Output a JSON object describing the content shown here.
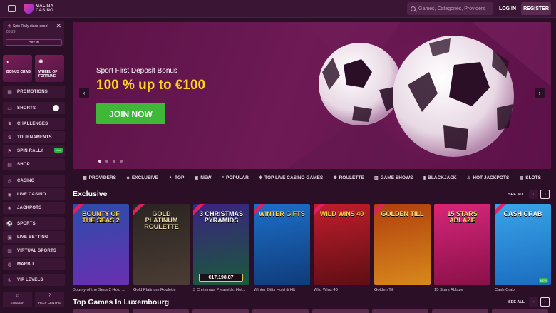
{
  "header": {
    "logo_line1": "MALINA",
    "logo_line2": "CASINO",
    "search_placeholder": "Games, Categories, Providers",
    "login_label": "LOG IN",
    "register_label": "REGISTER"
  },
  "sidebar": {
    "notice": {
      "text": "Spin Rally starts soon!",
      "time": "00:29",
      "button": "OPT IN"
    },
    "tiles": [
      {
        "label": "BONUS CRAB",
        "icon": "crab-icon"
      },
      {
        "label": "WHEEL OF FORTUNE",
        "icon": "wheel-icon"
      }
    ],
    "items": [
      {
        "label": "PROMOTIONS",
        "icon": "gift-icon"
      },
      {
        "label": "SHORTS",
        "icon": "video-icon"
      },
      {
        "label": "CHALLENGES",
        "icon": "trophy-icon"
      },
      {
        "label": "TOURNAMENTS",
        "icon": "cup-icon"
      },
      {
        "label": "SPIN RALLY",
        "icon": "runner-icon",
        "badge": "New"
      },
      {
        "label": "SHOP",
        "icon": "cart-icon"
      },
      {
        "label": "CASINO",
        "icon": "chip-icon"
      },
      {
        "label": "LIVE CASINO",
        "icon": "live-icon"
      },
      {
        "label": "JACKPOTS",
        "icon": "jackpot-icon"
      },
      {
        "label": "SPORTS",
        "icon": "ball-icon"
      },
      {
        "label": "LIVE BETTING",
        "icon": "live-bet-icon"
      },
      {
        "label": "VIRTUAL SPORTS",
        "icon": "virtual-icon"
      },
      {
        "label": "MARBU",
        "icon": "marbu-icon"
      },
      {
        "label": "VIP LEVELS",
        "icon": "crown-icon"
      }
    ],
    "footer": [
      {
        "label": "ENGLISH",
        "icon": "flag-icon"
      },
      {
        "label": "HELP CENTRE",
        "icon": "help-icon"
      }
    ]
  },
  "banner": {
    "title": "Sport First Deposit Bonus",
    "headline": "100 % up to €100",
    "cta": "JOIN NOW",
    "slides": 4,
    "active_slide": 1
  },
  "categories": [
    {
      "label": "PROVIDERS",
      "icon": "grid-icon"
    },
    {
      "label": "EXCLUSIVE",
      "icon": "diamond-icon"
    },
    {
      "label": "TOP",
      "icon": "top-icon"
    },
    {
      "label": "NEW",
      "icon": "new-icon"
    },
    {
      "label": "POPULAR",
      "icon": "flash-icon"
    },
    {
      "label": "TOP LIVE CASINO GAMES",
      "icon": "live-casino-icon"
    },
    {
      "label": "ROULETTE",
      "icon": "roulette-icon"
    },
    {
      "label": "GAME SHOWS",
      "icon": "show-icon"
    },
    {
      "label": "BLACKJACK",
      "icon": "cards-icon"
    },
    {
      "label": "HOT JACKPOTS",
      "icon": "fire-icon"
    },
    {
      "label": "SLOTS",
      "icon": "slots-icon"
    }
  ],
  "exclusive": {
    "title": "Exclusive",
    "see_all": "SEE ALL",
    "games": [
      {
        "name": "Bounty of the Seas 2 Hold ...",
        "art": "BOUNTY OF THE SEAS 2",
        "colors": [
          "#2c4da8",
          "#6a2fb2"
        ],
        "text": "#ffd24a"
      },
      {
        "name": "Gold Platinum Roulette",
        "art": "GOLD PLATINUM ROULETTE",
        "colors": [
          "#2a2422",
          "#4b3d34"
        ],
        "text": "#e9d7a8"
      },
      {
        "name": "3 Christmas Pyramids: Hol...",
        "art": "3 CHRISTMAS PYRAMIDS",
        "colors": [
          "#3b2380",
          "#1a5a3a"
        ],
        "text": "#ffffff",
        "jackpot": "€17,198.87"
      },
      {
        "name": "Winter Gifts Hold & Hit",
        "art": "WINTER GIFTS",
        "colors": [
          "#1d6fc7",
          "#0f3b7a"
        ],
        "text": "#ffd24a"
      },
      {
        "name": "Wild Wins 40",
        "art": "WILD WINS 40",
        "colors": [
          "#c01e2b",
          "#5e0e14"
        ],
        "text": "#ffd24a"
      },
      {
        "name": "Golden Till",
        "art": "GOLDEN TILL",
        "colors": [
          "#b0400e",
          "#d8881d"
        ],
        "text": "#ffe27a"
      },
      {
        "name": "15 Stars Ablaze",
        "art": "15 STARS ABLAZE",
        "colors": [
          "#d6267a",
          "#8a1048"
        ],
        "text": "#ffe27a"
      },
      {
        "name": "Cash Crab",
        "art": "CASH CRAB",
        "colors": [
          "#3aa4e8",
          "#1b6cc0"
        ],
        "text": "#ffffff",
        "new": "NEW"
      }
    ]
  },
  "top_games": {
    "title": "Top Games In Luxembourg",
    "see_all": "SEE ALL"
  }
}
